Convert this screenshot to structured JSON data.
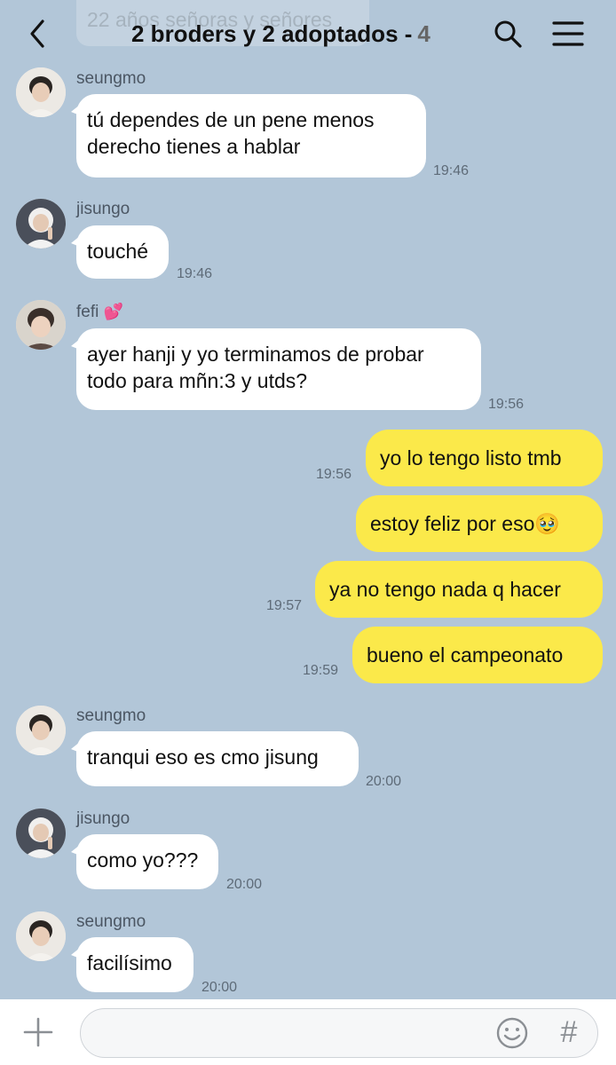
{
  "header": {
    "ghost_banner": "22 años señoras y señores",
    "title": "2 broders y 2 adoptados -",
    "member_count": "4"
  },
  "messages": [
    {
      "sender": "seungmo",
      "text": "tú dependes de un pene menos\nderecho tienes a hablar",
      "time": "19:46",
      "direction": "in"
    },
    {
      "sender": "jisungo",
      "text": "touché",
      "time": "19:46",
      "direction": "in"
    },
    {
      "sender": "fefi",
      "sender_decoration": "💕",
      "text": "ayer hanji y yo terminamos de probar\ntodo para mñn:3 y utds?",
      "time": "19:56",
      "direction": "in"
    },
    {
      "text": "yo lo tengo listo tmb",
      "time": "19:56",
      "direction": "out"
    },
    {
      "text": "estoy feliz por eso🥹",
      "time": "",
      "direction": "out"
    },
    {
      "text": "ya no tengo nada q hacer",
      "time": "19:57",
      "direction": "out"
    },
    {
      "text": "bueno el campeonato",
      "time": "19:59",
      "direction": "out"
    },
    {
      "sender": "seungmo",
      "text": "tranqui eso es cmo jisung",
      "time": "20:00",
      "direction": "in"
    },
    {
      "sender": "jisungo",
      "text": "como yo???",
      "time": "20:00",
      "direction": "in"
    },
    {
      "sender": "seungmo",
      "text": "facilísimo",
      "time": "20:00",
      "direction": "in"
    }
  ],
  "composer": {
    "placeholder": "",
    "hash_label": "#"
  },
  "colors": {
    "background": "#b2c6d8",
    "incoming_bubble": "#ffffff",
    "outgoing_bubble": "#fbe94a"
  }
}
